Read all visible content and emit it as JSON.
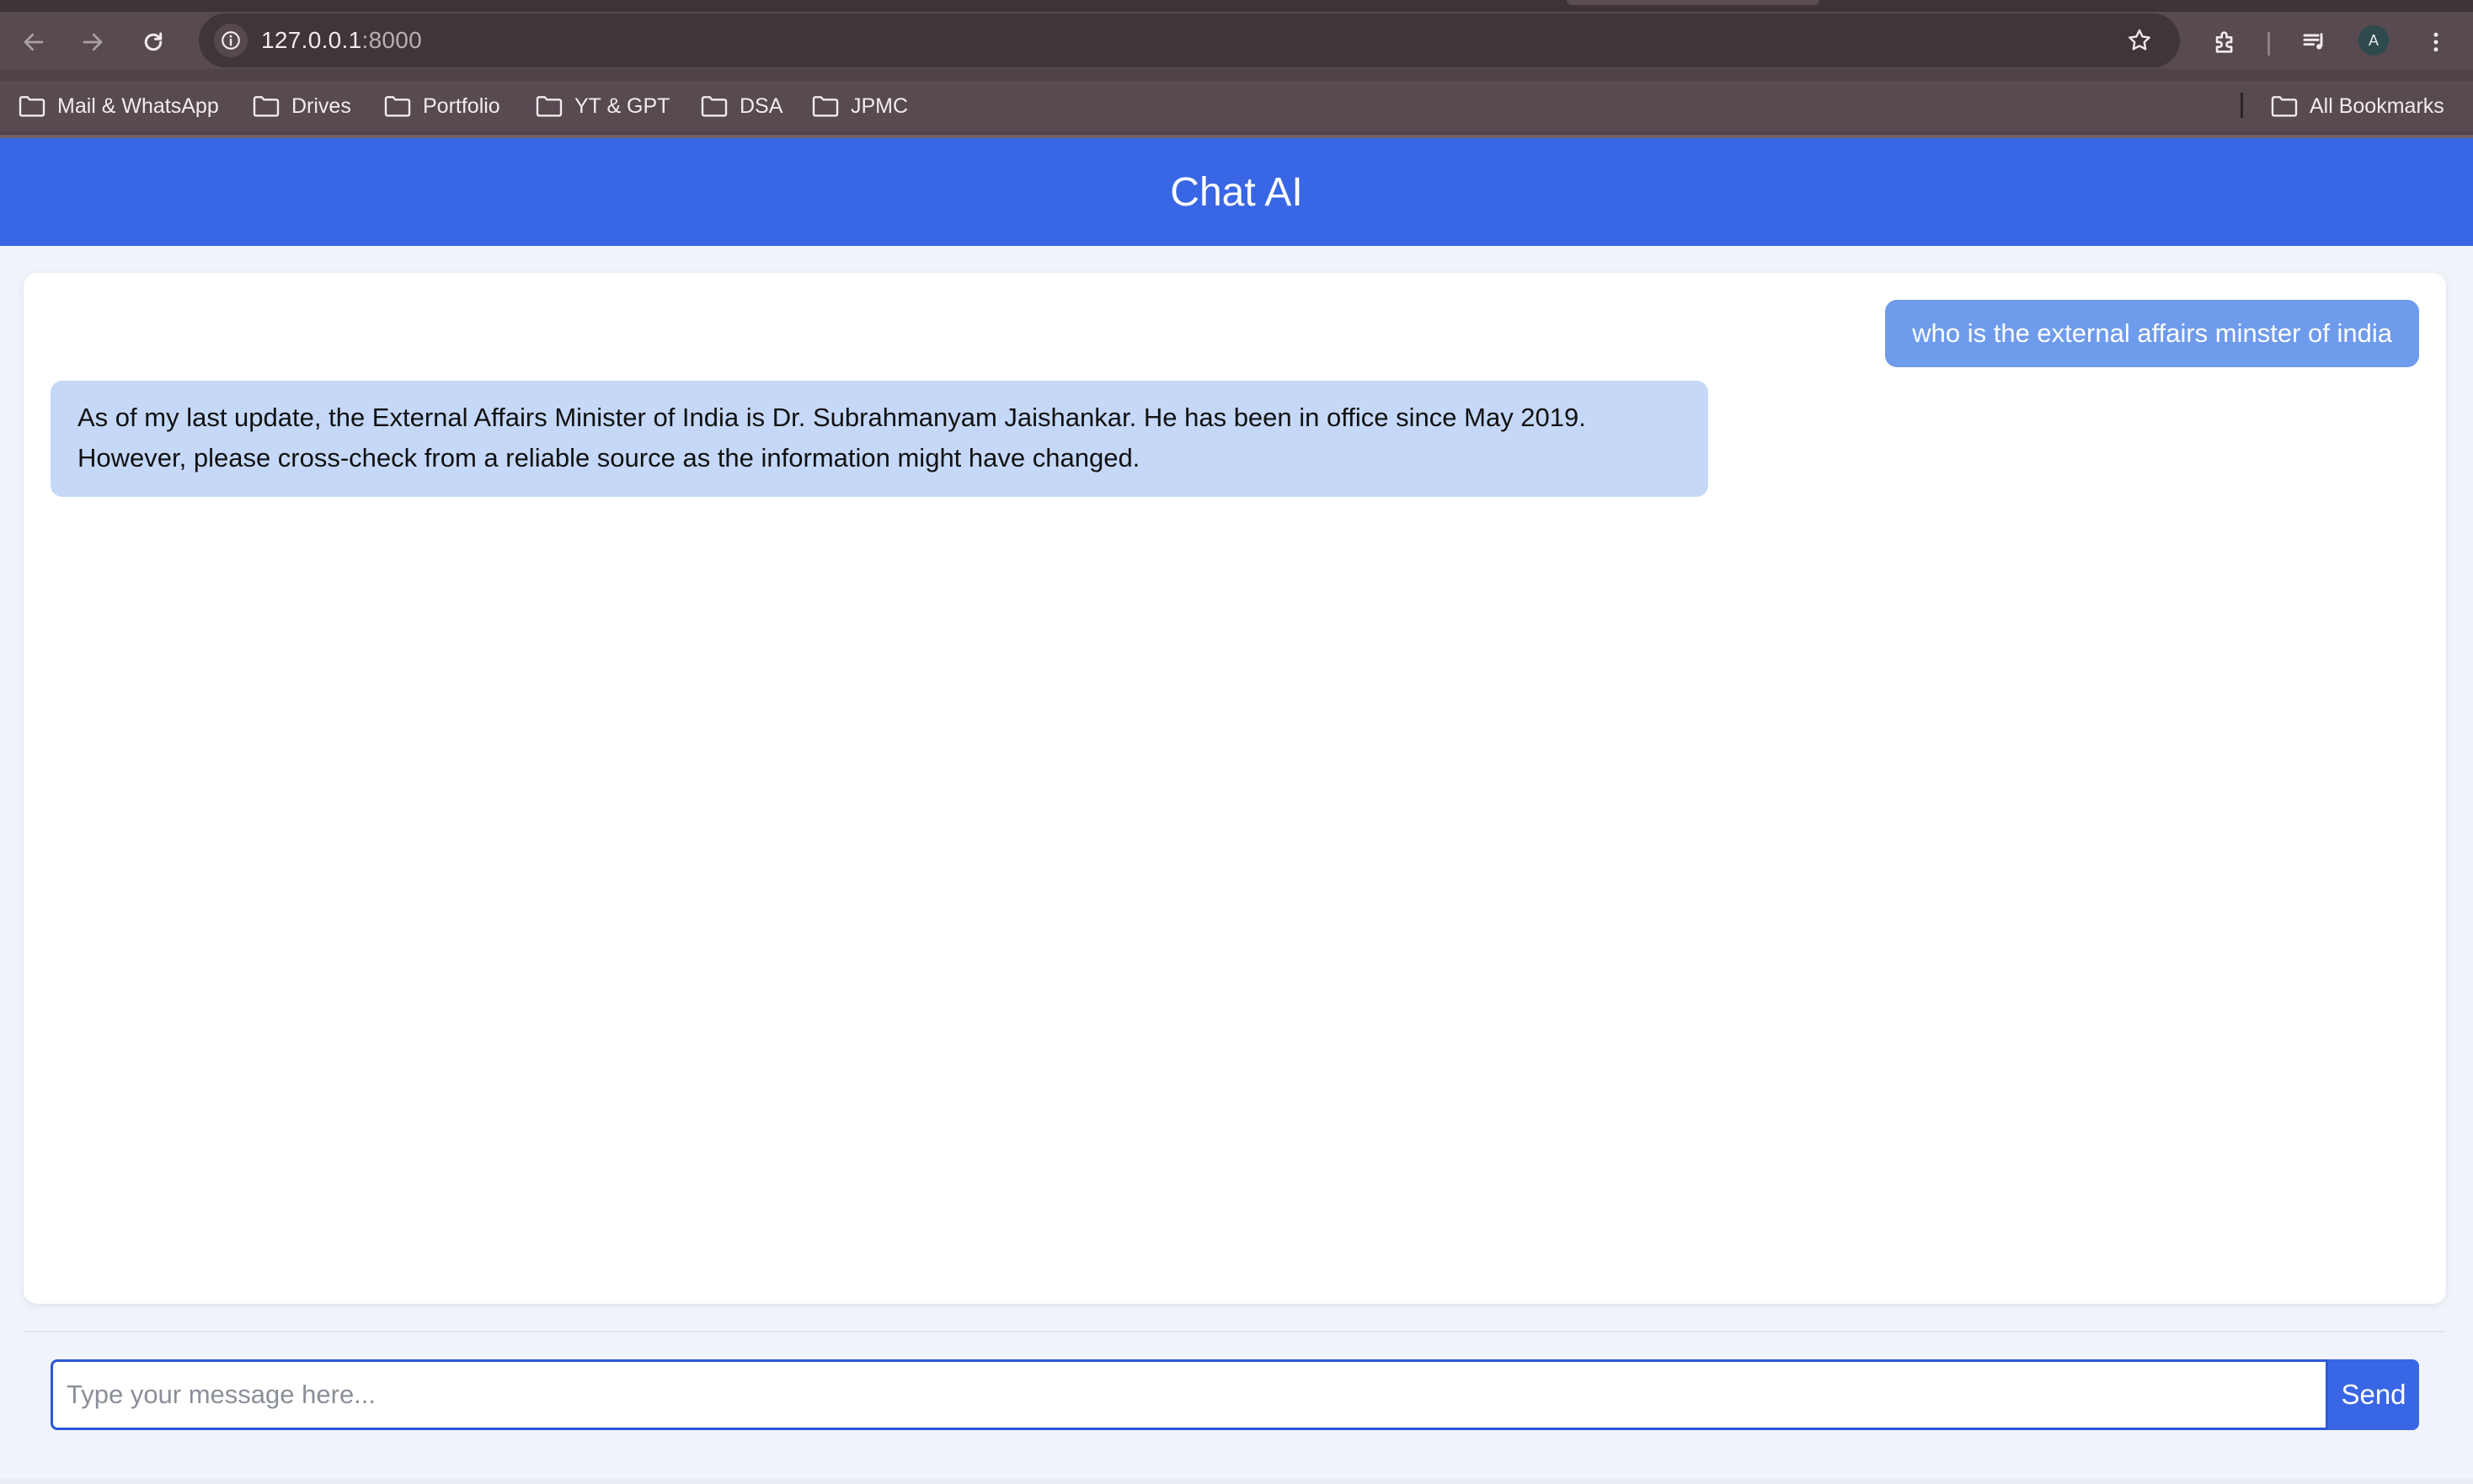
{
  "browser": {
    "url_host": "127.0.0.1",
    "url_port": ":8000",
    "profile_initial": "A",
    "icons": {
      "back": "back-arrow-icon",
      "forward": "forward-arrow-icon",
      "reload": "reload-icon",
      "site_info": "info-icon",
      "bookmark": "star-icon",
      "extensions": "puzzle-icon",
      "media": "media-queue-icon",
      "menu": "kebab-menu-icon"
    },
    "bookmarks": [
      {
        "label": "Mail & WhatsApp"
      },
      {
        "label": "Drives"
      },
      {
        "label": "Portfolio"
      },
      {
        "label": "YT & GPT"
      },
      {
        "label": "DSA"
      },
      {
        "label": "JPMC"
      }
    ],
    "all_bookmarks_label": "All Bookmarks"
  },
  "app": {
    "title": "Chat AI",
    "messages": [
      {
        "role": "user",
        "text": "who is the external affairs minster of india"
      },
      {
        "role": "assistant",
        "text": "As of my last update, the External Affairs Minister of India is Dr. Subrahmanyam Jaishankar. He has been in office since May 2019. However, please cross-check from a reliable source as the information might have changed."
      }
    ],
    "composer": {
      "placeholder": "Type your message here...",
      "value": "",
      "send_label": "Send"
    }
  },
  "colors": {
    "header_bg": "#3966e4",
    "user_bubble": "#6f9bec",
    "assistant_bubble": "#c5d8f8",
    "send_button": "#3966e4",
    "page_bg": "#f0f4fa"
  }
}
